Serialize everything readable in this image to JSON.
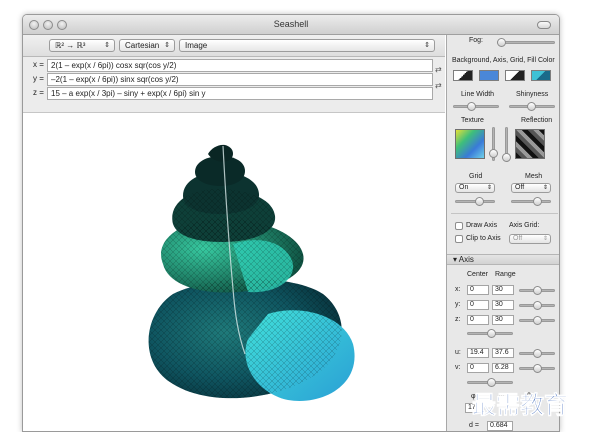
{
  "window": {
    "title": "Seashell"
  },
  "toolbar": {
    "mapping": "ℝ² → ℝ³",
    "coords": "Cartesian",
    "mode": "Image"
  },
  "equations": [
    {
      "var": "x =",
      "expr": "2(1 – exp(x / 6pi)) cosx sqr(cos y/2)"
    },
    {
      "var": "y =",
      "expr": "–2(1 – exp(x / 6pi)) sinx sqr(cos y/2)"
    },
    {
      "var": "z =",
      "expr": "15 – a exp(x / 3pi) – siny + exp(x / 6pi) sin y"
    }
  ],
  "panel": {
    "fog_label": "Fog:",
    "colors_label": "Background, Axis, Grid, Fill Color",
    "colors": {
      "background": "#ffffff",
      "axis": "#000000",
      "grid": "#4a87d8",
      "fill": "#3fc2d6"
    },
    "line_width_label": "Line Width",
    "shininess_label": "Shinyness",
    "texture_label": "Texture",
    "reflection_label": "Reflection",
    "grid_label": "Grid",
    "grid_value": "On",
    "mesh_label": "Mesh",
    "mesh_value": "Off",
    "draw_axis_label": "Draw Axis",
    "axis_grid_label": "Axis Grid:",
    "clip_axis_label": "Clip to Axis",
    "axis_grid_value": "Off",
    "axis_section": "Axis",
    "center_header": "Center",
    "range_header": "Range",
    "axes": [
      {
        "label": "x:",
        "center": "0",
        "range": "30"
      },
      {
        "label": "y:",
        "center": "0",
        "range": "30"
      },
      {
        "label": "z:",
        "center": "0",
        "range": "30"
      }
    ],
    "params": [
      {
        "label": "u:",
        "center": "19.4",
        "range": "37.6"
      },
      {
        "label": "v:",
        "center": "0",
        "range": "6.28"
      }
    ],
    "angle_headers": [
      "φ",
      "ψ",
      "θ"
    ],
    "angle_value": "17",
    "d_label": "d =",
    "d_value": "0.684"
  },
  "watermark": {
    "text": "最需教育"
  }
}
